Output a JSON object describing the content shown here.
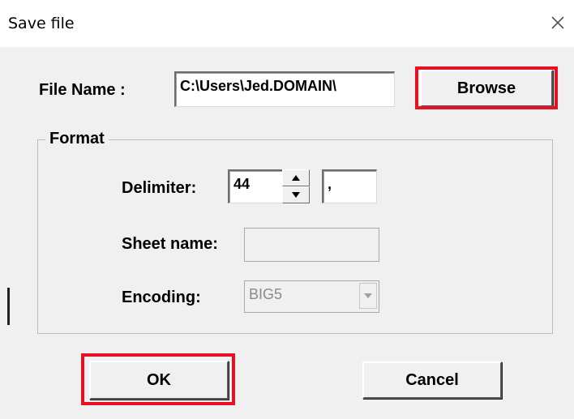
{
  "window": {
    "title": "Save file",
    "close_glyph": "✕"
  },
  "file_name": {
    "label": "File Name :",
    "value": "C:\\Users\\Jed.DOMAIN\\",
    "browse_label": "Browse"
  },
  "format": {
    "group_label": "Format",
    "delimiter_label": "Delimiter:",
    "delimiter_code": "44",
    "delimiter_char": ",",
    "sheet_name_label": "Sheet name:",
    "sheet_name_value": "",
    "encoding_label": "Encoding:",
    "encoding_value": "BIG5"
  },
  "buttons": {
    "ok_label": "OK",
    "cancel_label": "Cancel"
  },
  "colors": {
    "highlight": "#e81123",
    "window_bg": "#f0f0f0"
  },
  "icons": {
    "close": "close-icon",
    "spin_up": "arrow-up-icon",
    "spin_down": "arrow-down-icon",
    "dropdown": "chevron-down-icon"
  }
}
